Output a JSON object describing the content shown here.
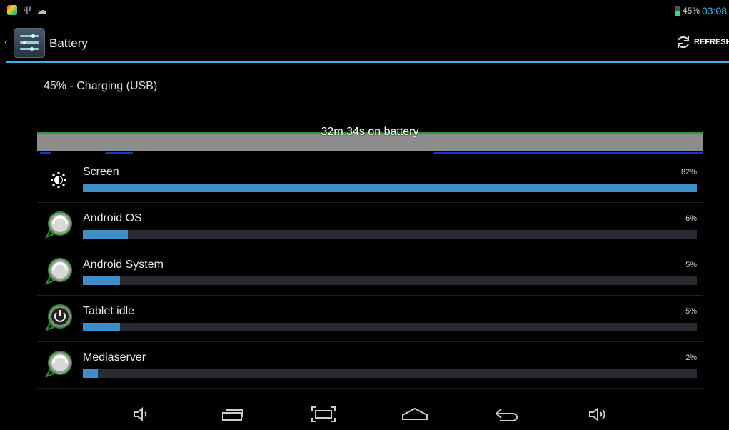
{
  "status_bar": {
    "battery_percent": "45%",
    "time": "03:08",
    "icons": [
      "gallery-app-icon",
      "usb-icon",
      "android-debug-icon",
      "battery-charging-icon"
    ]
  },
  "action_bar": {
    "title": "Battery",
    "refresh_label": "REFRESH"
  },
  "summary": {
    "status_text": "45% - Charging (USB)"
  },
  "history": {
    "label": "32m 34s on battery"
  },
  "usage": [
    {
      "label": "Screen",
      "percent": "82%",
      "value": 82,
      "icon": "brightness-icon"
    },
    {
      "label": "Android OS",
      "percent": "6%",
      "value": 6,
      "icon": "android-app-icon"
    },
    {
      "label": "Android System",
      "percent": "5%",
      "value": 5,
      "icon": "android-app-icon"
    },
    {
      "label": "Tablet idle",
      "percent": "5%",
      "value": 5,
      "icon": "power-icon"
    },
    {
      "label": "Mediaserver",
      "percent": "2%",
      "value": 2,
      "icon": "android-app-icon"
    }
  ],
  "nav_bar": {
    "buttons": [
      "volume-down-icon",
      "recent-apps-icon",
      "screenshot-icon",
      "home-icon",
      "back-icon",
      "volume-up-icon"
    ]
  },
  "colors": {
    "accent": "#33b5e5",
    "usage_bar": "#3f8ec7",
    "usage_track": "#2a2a33",
    "history_fill": "#8c8c8c",
    "history_line": "#2c9a2c"
  }
}
